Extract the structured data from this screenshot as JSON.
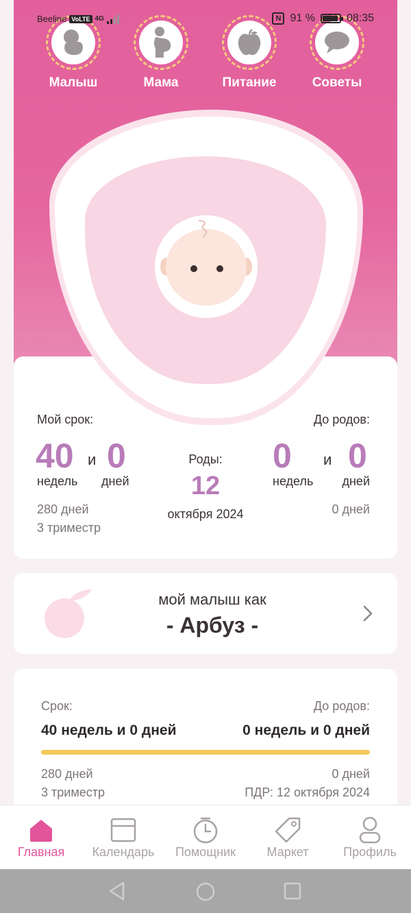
{
  "status_bar": {
    "carrier": "Beeline",
    "volte": "VoLTE",
    "network": "4G",
    "battery": "91 %",
    "time": "08:35",
    "nfc": "N"
  },
  "categories": [
    {
      "label": "Малыш",
      "icon": "baby-fetus-icon"
    },
    {
      "label": "Мама",
      "icon": "pregnant-mother-icon"
    },
    {
      "label": "Питание",
      "icon": "apple-icon"
    },
    {
      "label": "Советы",
      "icon": "speech-bubble-icon"
    }
  ],
  "term_card": {
    "my_term_label": "Мой срок:",
    "weeks_value": "40",
    "and": "и",
    "days_value": "0",
    "weeks_unit": "недель",
    "days_unit": "дней",
    "total_days": "280 дней",
    "trimester": "3 триместр",
    "birth_label": "Роды:",
    "birth_day": "12",
    "birth_month_year": "октября 2024",
    "until_birth_label": "До родов:",
    "until_weeks_value": "0",
    "until_days_value": "0",
    "until_total_days": "0 дней"
  },
  "fruit_card": {
    "line1": "мой малыш как",
    "fruit": "- Арбуз -",
    "icon": "fruit-icon"
  },
  "progress_card": {
    "term_label": "Срок:",
    "term_value": "40 недель и 0 дней",
    "until_label": "До родов:",
    "until_value": "0 недель и 0 дней",
    "progress": 1.0,
    "progress_color": "#f5c95a",
    "total_days": "280 дней",
    "trimester": "3 триместр",
    "until_days": "0 дней",
    "pdr": "ПДР: 12 октября 2024"
  },
  "bottom_nav": [
    {
      "label": "Главная",
      "icon": "home-icon",
      "active": true
    },
    {
      "label": "Календарь",
      "icon": "calendar-icon",
      "active": false
    },
    {
      "label": "Помощник",
      "icon": "timer-icon",
      "active": false
    },
    {
      "label": "Маркет",
      "icon": "tag-icon",
      "active": false
    },
    {
      "label": "Профиль",
      "icon": "profile-icon",
      "active": false
    }
  ],
  "colors": {
    "accent": "#e25f9c",
    "purple": "#b87cb8",
    "dashed_ring": "#f6c87d"
  }
}
